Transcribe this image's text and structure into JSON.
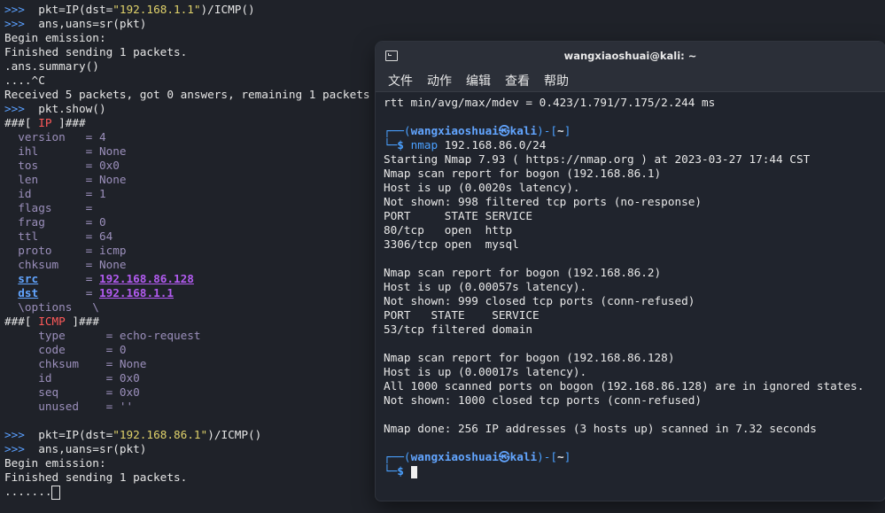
{
  "left_terminal": {
    "prompt": ">>>",
    "l1_pre": "pkt=IP(dst=",
    "l1_str": "\"192.168.1.1\"",
    "l1_post": ")/ICMP()",
    "l2": "ans,uans=sr(pkt)",
    "l3": "Begin emission:",
    "l4": "Finished sending 1 packets.",
    "l5": ".ans.summary()",
    "l6": "....^C",
    "l7": "Received 5 packets, got 0 answers, remaining 1 packets",
    "l8": "pkt.show()",
    "ip_open": "###[ ",
    "ip_name": "IP",
    "ip_close": " ]###",
    "ip_fields": [
      {
        "name": "version",
        "value": "4"
      },
      {
        "name": "ihl",
        "value": "None"
      },
      {
        "name": "tos",
        "value": "0x0"
      },
      {
        "name": "len",
        "value": "None"
      },
      {
        "name": "id",
        "value": "1"
      },
      {
        "name": "flags",
        "value": ""
      },
      {
        "name": "frag",
        "value": "0"
      },
      {
        "name": "ttl",
        "value": "64"
      },
      {
        "name": "proto",
        "value": "icmp"
      },
      {
        "name": "chksum",
        "value": "None"
      }
    ],
    "src_name": "src",
    "src_value": "192.168.86.128",
    "dst_name": "dst",
    "dst_value": "192.168.1.1",
    "options": "\\options   \\",
    "icmp_name": "ICMP",
    "icmp_fields": [
      {
        "name": "type",
        "value": "echo-request"
      },
      {
        "name": "code",
        "value": "0"
      },
      {
        "name": "chksum",
        "value": "None"
      },
      {
        "name": "id",
        "value": "0x0"
      },
      {
        "name": "seq",
        "value": "0x0"
      },
      {
        "name": "unused",
        "value": "''"
      }
    ],
    "l9_str": "\"192.168.86.1\"",
    "l10": "ans,uans=sr(pkt)",
    "l11": "Begin emission:",
    "l12": "Finished sending 1 packets.",
    "l13": "......."
  },
  "window": {
    "title": "wangxiaoshuai@kali: ~",
    "menu": [
      "文件",
      "动作",
      "编辑",
      "查看",
      "帮助"
    ],
    "rtt": "rtt min/avg/max/mdev = 0.423/1.791/7.175/2.244 ms",
    "user": "wangxiaoshuai",
    "at": "㉿",
    "host": "kali",
    "path": "~",
    "cmd": "nmap",
    "cmd_arg": " 192.168.86.0/24",
    "out": [
      "Starting Nmap 7.93 ( https://nmap.org ) at 2023-03-27 17:44 CST",
      "Nmap scan report for bogon (192.168.86.1)",
      "Host is up (0.0020s latency).",
      "Not shown: 998 filtered tcp ports (no-response)",
      "PORT     STATE SERVICE",
      "80/tcp   open  http",
      "3306/tcp open  mysql",
      "",
      "Nmap scan report for bogon (192.168.86.2)",
      "Host is up (0.00057s latency).",
      "Not shown: 999 closed tcp ports (conn-refused)",
      "PORT   STATE    SERVICE",
      "53/tcp filtered domain",
      "",
      "Nmap scan report for bogon (192.168.86.128)",
      "Host is up (0.00017s latency).",
      "All 1000 scanned ports on bogon (192.168.86.128) are in ignored states.",
      "Not shown: 1000 closed tcp ports (conn-refused)",
      "",
      "Nmap done: 256 IP addresses (3 hosts up) scanned in 7.32 seconds"
    ]
  }
}
